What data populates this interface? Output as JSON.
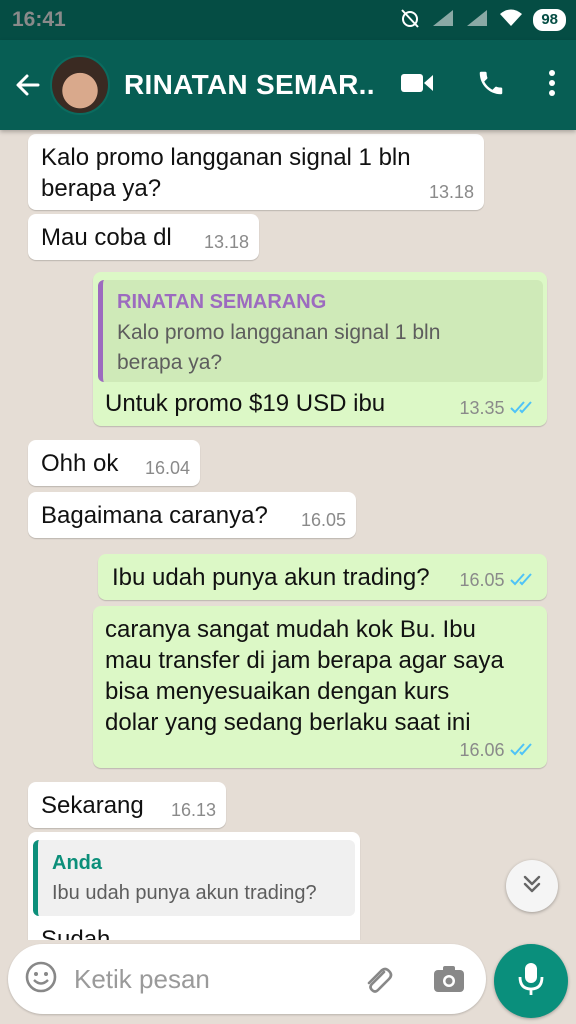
{
  "status_bar": {
    "time": "16:41",
    "battery": "98"
  },
  "header": {
    "contact_name": "RINATAN SEMAR..."
  },
  "messages": [
    {
      "dir": "in",
      "lines": [
        "Kalo promo langganan signal 1 bln",
        "berapa ya?"
      ],
      "time": "13.18"
    },
    {
      "dir": "in",
      "text": "Mau coba dl",
      "time": "13.18"
    },
    {
      "dir": "out",
      "quote_name": "RINATAN SEMARANG",
      "quote_lines": [
        "Kalo promo langganan signal 1 bln",
        "berapa ya?"
      ],
      "text": "Untuk promo $19 USD ibu",
      "time": "13.35"
    },
    {
      "dir": "in",
      "text": "Ohh ok",
      "time": "16.04"
    },
    {
      "dir": "in",
      "text": "Bagaimana caranya?",
      "time": "16.05"
    },
    {
      "dir": "out",
      "text": "Ibu udah punya akun trading?",
      "time": "16.05"
    },
    {
      "dir": "out",
      "lines": [
        "caranya sangat mudah kok Bu. Ibu",
        "mau transfer di jam berapa agar saya",
        "bisa menyesuaikan dengan kurs",
        "dolar yang sedang berlaku saat ini"
      ],
      "time": "16.06"
    },
    {
      "dir": "in",
      "text": "Sekarang",
      "time": "16.13"
    },
    {
      "dir": "in",
      "quote_name": "Anda",
      "quote_text": "Ibu udah punya akun trading?",
      "text": "Sudah"
    }
  ],
  "composer": {
    "placeholder": "Ketik pesan"
  },
  "colors": {
    "header": "#075e54",
    "statusbar": "#054d44",
    "outgoing": "#dcf8c6",
    "incoming": "#ffffff",
    "read_tick": "#4fc3f7",
    "mic": "#0a8f7c"
  }
}
